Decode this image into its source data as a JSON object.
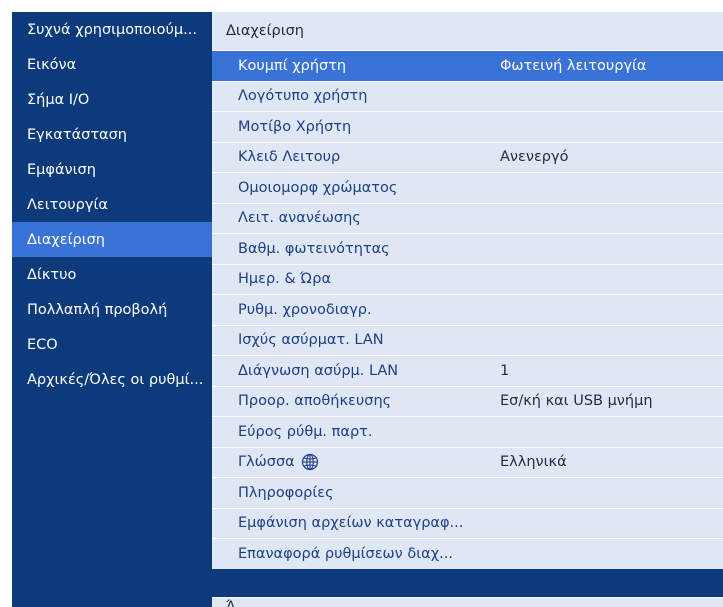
{
  "sidebar": {
    "items": [
      {
        "label": "Συχνά χρησιμοποιούμ..."
      },
      {
        "label": "Εικόνα"
      },
      {
        "label": "Σήμα I/O"
      },
      {
        "label": "Εγκατάσταση"
      },
      {
        "label": "Εμφάνιση"
      },
      {
        "label": "Λειτουργία"
      },
      {
        "label": "Διαχείριση",
        "selected": true
      },
      {
        "label": "Δίκτυο"
      },
      {
        "label": "Πολλαπλή προβολή"
      },
      {
        "label": "ECO"
      },
      {
        "label": "Αρχικές/Όλες οι ρυθμί..."
      }
    ]
  },
  "panel": {
    "title": "Διαχείριση",
    "rows": [
      {
        "label": "Κουμπί χρήστη",
        "value": "Φωτεινή λειτουργία",
        "selected": true
      },
      {
        "label": "Λογότυπο χρήστη",
        "value": ""
      },
      {
        "label": "Μοτίβο Χρήστη",
        "value": ""
      },
      {
        "label": "Κλειδ Λειτουρ",
        "value": "Ανενεργό"
      },
      {
        "label": "Ομοιομορφ χρώματος",
        "value": ""
      },
      {
        "label": "Λειτ. ανανέωσης",
        "value": ""
      },
      {
        "label": "Βαθμ. φωτεινότητας",
        "value": ""
      },
      {
        "label": "Ημερ. & Ώρα",
        "value": ""
      },
      {
        "label": "Ρυθμ. χρονοδιαγρ.",
        "value": ""
      },
      {
        "label": "Ισχύς ασύρματ. LAN",
        "value": ""
      },
      {
        "label": "Διάγνωση ασύρμ. LAN",
        "value": "1"
      },
      {
        "label": "Προορ. αποθήκευσης",
        "value": "Εσ/κή και USB μνήμη"
      },
      {
        "label": "Εύρος ρύθμ. παρτ.",
        "value": ""
      },
      {
        "label": "Γλώσσα",
        "value": "Ελληνικά",
        "icon": "globe-icon"
      },
      {
        "label": "Πληροφορίες",
        "value": ""
      },
      {
        "label": "Εμφάνιση αρχείων καταγραφ...",
        "value": ""
      },
      {
        "label": "Επαναφορά ρυθμίσεων διαχ...",
        "value": ""
      }
    ],
    "footer": "Ά..."
  },
  "colors": {
    "frame_bg": "#0d3a7a",
    "highlight": "#3a73d8",
    "row_bg": "#dfe7f5",
    "row_text": "#1d3f86",
    "value_text": "#1d2d45"
  }
}
